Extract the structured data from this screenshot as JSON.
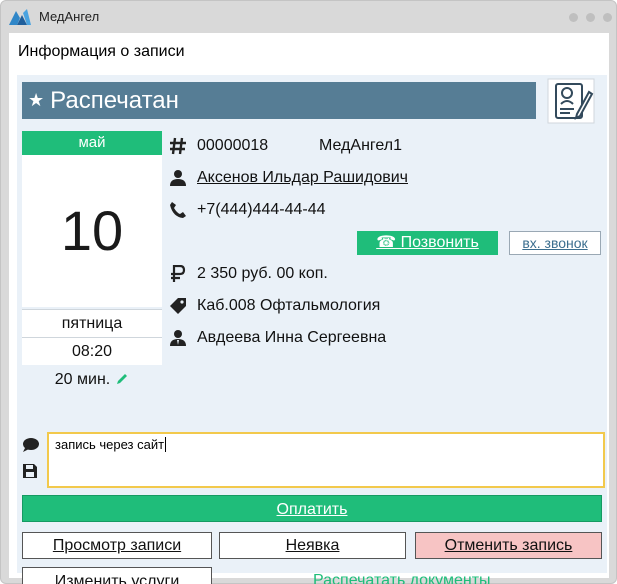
{
  "window": {
    "app_title": "МедАнгел"
  },
  "panel": {
    "title": "Информация о записи"
  },
  "status": {
    "label": "Распечатан"
  },
  "calendar": {
    "month": "май",
    "day": "10",
    "weekday": "пятница",
    "time": "08:20",
    "duration": "20 мин."
  },
  "record": {
    "number": "00000018",
    "source": "МедАнгел1",
    "patient_name": "Аксенов Ильдар Рашидович",
    "phone": "+7(444)444-44-44",
    "price": "2 350 руб. 00 коп.",
    "service": "Каб.008 Офтальмология",
    "doctor": "Авдеева Инна Сергеевна"
  },
  "phone_actions": {
    "call_label": "☎ Позвонить",
    "incoming_call_label": "вх. звонок"
  },
  "comment": {
    "value": "запись через сайт"
  },
  "actions": {
    "pay": "Оплатить",
    "view_record": "Просмотр записи",
    "no_show": "Неявка",
    "cancel_record": "Отменить запись",
    "edit_services": "Изменить услуги",
    "print_documents": "Распечатать документы"
  },
  "colors": {
    "accent_green": "#1fbd7a",
    "status_blue": "#567d95",
    "cancel_red": "#f7c4c4",
    "comment_border": "#f2c94c"
  }
}
